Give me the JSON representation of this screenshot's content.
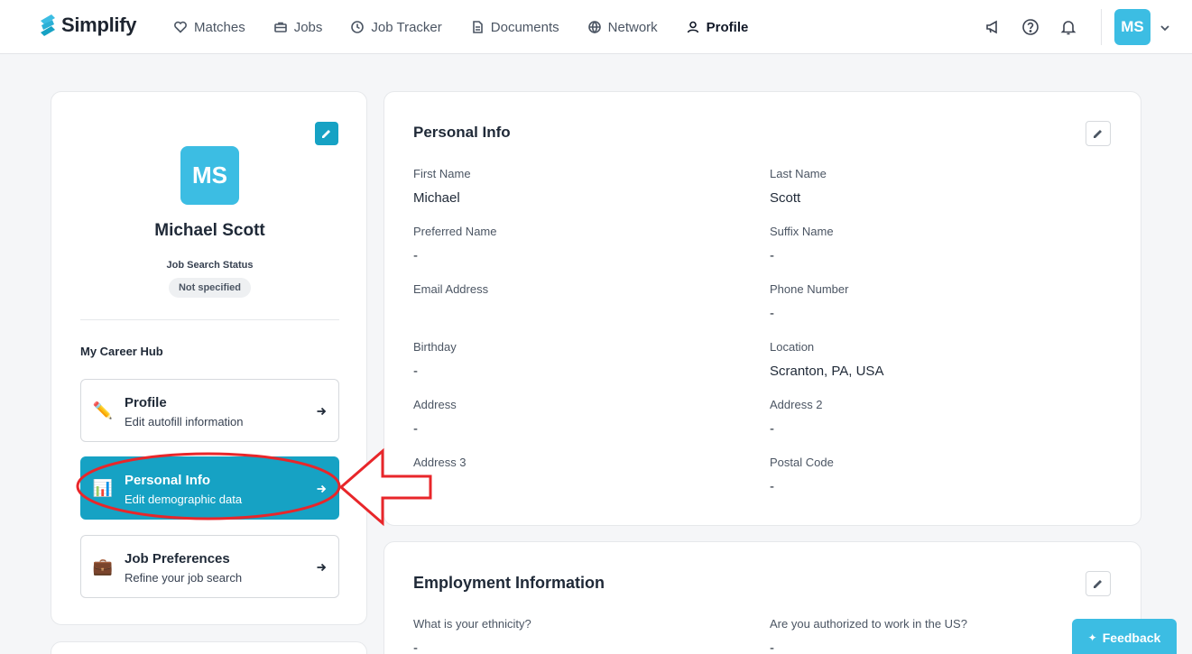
{
  "app": {
    "brand": "Simplify"
  },
  "nav": {
    "items": [
      {
        "label": "Matches",
        "icon": "heart-icon",
        "active": false
      },
      {
        "label": "Jobs",
        "icon": "briefcase-icon",
        "active": false
      },
      {
        "label": "Job Tracker",
        "icon": "clock-icon",
        "active": false
      },
      {
        "label": "Documents",
        "icon": "document-icon",
        "active": false
      },
      {
        "label": "Network",
        "icon": "globe-icon",
        "active": false
      },
      {
        "label": "Profile",
        "icon": "user-icon",
        "active": true
      }
    ],
    "right_icons": [
      "megaphone-icon",
      "help-icon",
      "bell-icon"
    ],
    "avatar_initials": "MS"
  },
  "profile_card": {
    "avatar_initials": "MS",
    "name": "Michael Scott",
    "status_label": "Job Search Status",
    "status_value": "Not specified",
    "hub_title": "My Career Hub",
    "hub_items": [
      {
        "title": "Profile",
        "subtitle": "Edit autofill information",
        "icon": "✏️",
        "active": false
      },
      {
        "title": "Personal Info",
        "subtitle": "Edit demographic data",
        "icon": "📊",
        "active": true
      },
      {
        "title": "Job Preferences",
        "subtitle": "Refine your job search",
        "icon": "💼",
        "active": false
      }
    ]
  },
  "personal_info": {
    "title": "Personal Info",
    "fields": [
      {
        "label": "First Name",
        "value": "Michael"
      },
      {
        "label": "Last Name",
        "value": "Scott"
      },
      {
        "label": "Preferred Name",
        "value": "-"
      },
      {
        "label": "Suffix Name",
        "value": "-"
      },
      {
        "label": "Email Address",
        "value": ""
      },
      {
        "label": "Phone Number",
        "value": "-"
      },
      {
        "label": "Birthday",
        "value": "-"
      },
      {
        "label": "Location",
        "value": "Scranton, PA, USA"
      },
      {
        "label": "Address",
        "value": "-"
      },
      {
        "label": "Address 2",
        "value": "-"
      },
      {
        "label": "Address 3",
        "value": "-"
      },
      {
        "label": "Postal Code",
        "value": "-"
      }
    ]
  },
  "employment_info": {
    "title": "Employment Information",
    "fields": [
      {
        "label": "What is your ethnicity?",
        "value": "-"
      },
      {
        "label": "Are you authorized to work in the US?",
        "value": "-"
      }
    ]
  },
  "feedback": {
    "label": "Feedback"
  },
  "colors": {
    "accent": "#16a2c4",
    "avatar": "#3cbde3",
    "annotation": "#e8262a"
  }
}
